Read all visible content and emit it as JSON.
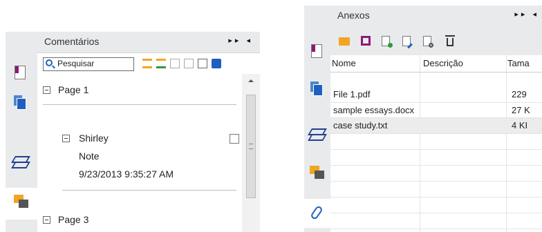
{
  "left_panel": {
    "title": "Comentários",
    "header_controls": "▸▸ ◂",
    "search": {
      "placeholder": "Pesquisar"
    },
    "items": [
      {
        "label": "Page 1"
      },
      {
        "author": "Shirley",
        "type": "Note",
        "date": "9/23/2013 9:35:27 AM"
      },
      {
        "label": "Page 3"
      }
    ]
  },
  "right_panel": {
    "title": "Anexos",
    "header_controls": "▸▸ ◂",
    "columns": [
      "Nome",
      "Descrição",
      "Tama"
    ],
    "rows": [
      {
        "name": "File 1.pdf",
        "description": "",
        "size": "229"
      },
      {
        "name": "sample essays.docx",
        "description": "",
        "size": "27 K"
      },
      {
        "name": "case study.txt",
        "description": "",
        "size": "4 KI"
      }
    ]
  },
  "colors": {
    "panel": "#e9eaec",
    "accent_blue": "#1f5fbf",
    "icon_orange": "#f0a623",
    "icon_purple": "#8a1a7a"
  },
  "icons": [
    "page-icon",
    "pages-icon",
    "layers-icon",
    "comments-icon",
    "attachment-icon",
    "open-folder-icon",
    "save-icon",
    "add-file-icon",
    "edit-icon",
    "settings-file-icon",
    "delete-icon"
  ]
}
